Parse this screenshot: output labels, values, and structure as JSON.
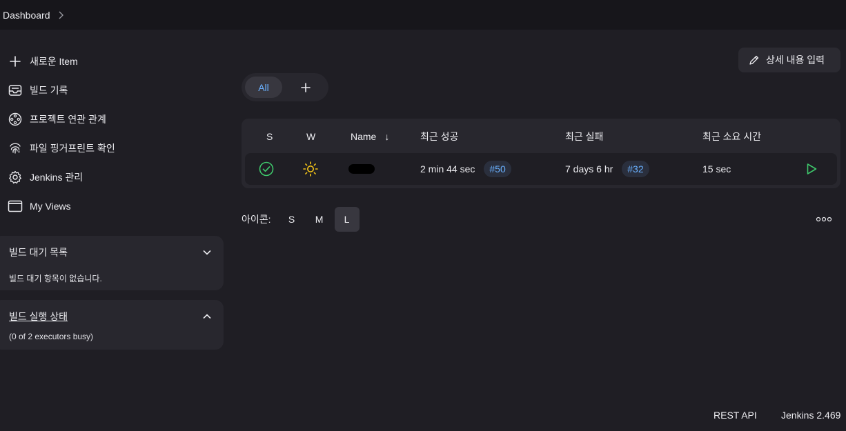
{
  "topbar": {
    "breadcrumb": "Dashboard"
  },
  "sidebar": {
    "items": [
      {
        "label": "새로운 Item",
        "icon": "plus-icon"
      },
      {
        "label": "빌드 기록",
        "icon": "inbox-icon"
      },
      {
        "label": "프로젝트 연관 관계",
        "icon": "relationship-icon"
      },
      {
        "label": "파일 핑거프린트 확인",
        "icon": "fingerprint-icon"
      },
      {
        "label": "Jenkins 관리",
        "icon": "gear-icon"
      },
      {
        "label": "My Views",
        "icon": "window-icon"
      }
    ]
  },
  "queue": {
    "title": "빌드 대기 목록",
    "empty": "빌드 대기 항목이 없습니다."
  },
  "executors": {
    "title": "빌드 실행 상태",
    "status": "(0 of 2 executors busy)"
  },
  "description_button": "상세 내용 입력",
  "tabs": {
    "all": "All"
  },
  "table": {
    "headers": {
      "s": "S",
      "w": "W",
      "name": "Name",
      "sort": "↓",
      "last_success": "최근 성공",
      "last_failure": "최근 실패",
      "last_duration": "최근 소요 시간"
    },
    "rows": [
      {
        "last_success": "2 min 44 sec",
        "success_build": "#50",
        "last_failure": "7 days 6 hr",
        "failure_build": "#32",
        "duration": "15 sec"
      }
    ]
  },
  "icon_size": {
    "label": "아이콘:",
    "options": [
      "S",
      "M",
      "L"
    ],
    "selected": "L"
  },
  "footer": {
    "rest_api": "REST API",
    "version": "Jenkins 2.469"
  },
  "colors": {
    "accent": "#6ab1ff",
    "success": "#3ec76b",
    "weather": "#f5c518",
    "background": "#1f1e24"
  }
}
